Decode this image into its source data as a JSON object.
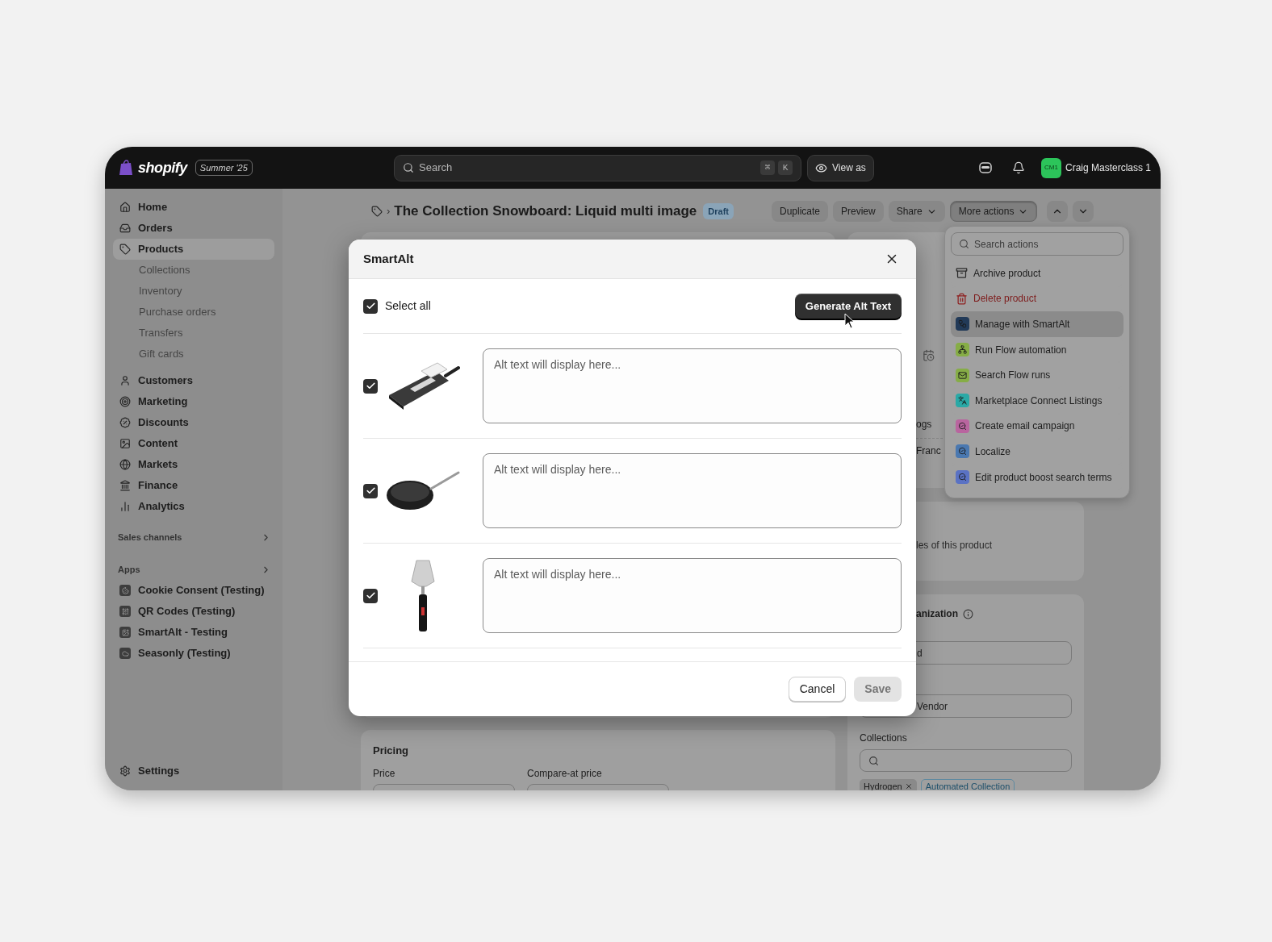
{
  "top_bar": {
    "logo": "shopify",
    "badge": "Summer '25",
    "search": {
      "placeholder": "Search",
      "keys": [
        "⌘",
        "K"
      ]
    },
    "view_as": "View as",
    "user": {
      "initials": "CM1",
      "name": "Craig Masterclass 1"
    }
  },
  "sidebar": {
    "items": [
      {
        "label": "Home",
        "selected": false
      },
      {
        "label": "Orders",
        "selected": false
      },
      {
        "label": "Products",
        "selected": true,
        "children": [
          {
            "label": "Collections"
          },
          {
            "label": "Inventory"
          },
          {
            "label": "Purchase orders"
          },
          {
            "label": "Transfers"
          },
          {
            "label": "Gift cards"
          }
        ]
      },
      {
        "label": "Customers",
        "selected": false
      },
      {
        "label": "Marketing",
        "selected": false
      },
      {
        "label": "Discounts",
        "selected": false
      },
      {
        "label": "Content",
        "selected": false
      },
      {
        "label": "Markets",
        "selected": false
      },
      {
        "label": "Finance",
        "selected": false
      },
      {
        "label": "Analytics",
        "selected": false
      }
    ],
    "sections": [
      {
        "label": "Sales channels"
      },
      {
        "label": "Apps",
        "items": [
          {
            "label": "Cookie Consent (Testing)"
          },
          {
            "label": "QR Codes (Testing)"
          },
          {
            "label": "SmartAlt - Testing"
          },
          {
            "label": "Seasonly (Testing)"
          }
        ]
      }
    ],
    "settings": "Settings"
  },
  "header": {
    "separator": "›",
    "title": "The Collection Snowboard: Liquid multi image",
    "status": "Draft",
    "buttons": [
      {
        "label": "Duplicate",
        "dropdown": false,
        "selected": false
      },
      {
        "label": "Preview",
        "dropdown": false,
        "selected": false
      },
      {
        "label": "Share",
        "dropdown": true,
        "selected": false
      },
      {
        "label": "More actions",
        "dropdown": true,
        "selected": true
      }
    ]
  },
  "actions_menu": {
    "placeholder": "Search actions",
    "items": [
      {
        "label": "Archive product",
        "kind": "plain",
        "selected": false
      },
      {
        "label": "Delete product",
        "kind": "destructive",
        "selected": false
      },
      {
        "label": "Manage with SmartAlt",
        "kind": "app",
        "color": "#223a58",
        "selected": true
      },
      {
        "label": "Run Flow automation",
        "kind": "app",
        "color": "#86ad46",
        "selected": false
      },
      {
        "label": "Search Flow runs",
        "kind": "app",
        "color": "#86ad46",
        "selected": false
      },
      {
        "label": "Marketplace Connect Listings",
        "kind": "app",
        "color": "#2aa9a6",
        "selected": false
      },
      {
        "label": "Create email campaign",
        "kind": "app",
        "color": "#b9659f",
        "selected": false
      },
      {
        "label": "Localize",
        "kind": "app",
        "color": "#4a78b0",
        "selected": false
      },
      {
        "label": "Edit product boost search terms",
        "kind": "app",
        "color": "#5a72c4",
        "selected": false
      }
    ]
  },
  "background": {
    "publishing": [
      "ogs",
      "Franc"
    ],
    "insights": "les of this product",
    "organization": {
      "title": "anization",
      "type_value": "d",
      "vendor_value": "Vendor",
      "collections_label": "Collections",
      "tags": [
        "Hydrogen",
        "Automated Collection"
      ]
    },
    "pricing": {
      "title": "Pricing",
      "fields": [
        "Price",
        "Compare-at price"
      ]
    }
  },
  "modal": {
    "title": "SmartAlt",
    "select_all": {
      "label": "Select all",
      "checked": true
    },
    "generate_button": "Generate Alt Text",
    "images": [
      {
        "kind": "slicer",
        "checked": true,
        "placeholder": "Alt text will display here..."
      },
      {
        "kind": "pan",
        "checked": true,
        "placeholder": "Alt text will display here..."
      },
      {
        "kind": "server",
        "checked": true,
        "placeholder": "Alt text will display here..."
      }
    ],
    "cancel": "Cancel",
    "save": {
      "label": "Save",
      "disabled": true
    }
  }
}
